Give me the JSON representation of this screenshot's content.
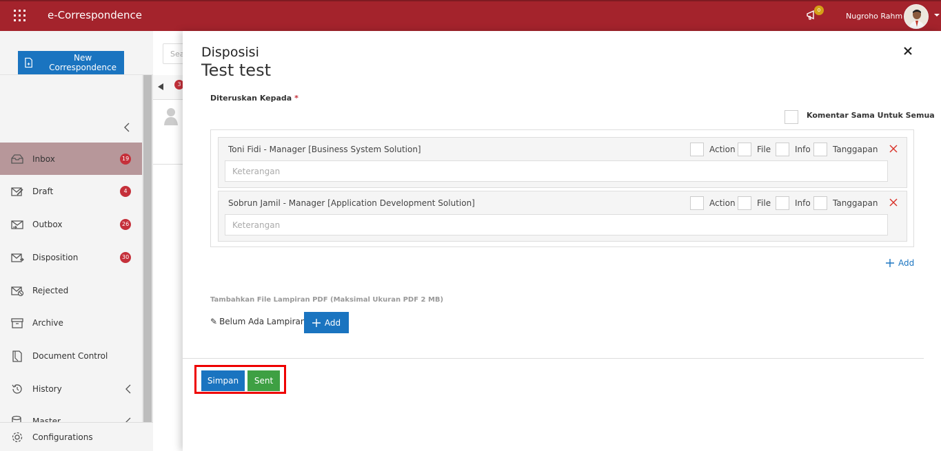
{
  "app": {
    "title": "e-Correspondence",
    "notification_count": "0",
    "user_name": "Nugroho Rahm"
  },
  "sidebar": {
    "new_button_label": "New Correspondence",
    "items": [
      {
        "label": "Inbox",
        "badge": "19",
        "icon": "inbox-icon",
        "active": true
      },
      {
        "label": "Draft",
        "badge": "4",
        "icon": "draft-icon"
      },
      {
        "label": "Outbox",
        "badge": "26",
        "icon": "outbox-icon"
      },
      {
        "label": "Disposition",
        "badge": "30",
        "icon": "disposition-icon"
      },
      {
        "label": "Rejected",
        "badge": "",
        "icon": "rejected-icon"
      },
      {
        "label": "Archive",
        "badge": "",
        "icon": "archive-icon"
      },
      {
        "label": "Document Control",
        "badge": "",
        "icon": "document-control-icon"
      },
      {
        "label": "History",
        "badge": "",
        "icon": "history-icon",
        "expandable": true
      },
      {
        "label": "Master",
        "badge": "",
        "icon": "master-icon",
        "expandable": true
      }
    ],
    "config_label": "Configurations"
  },
  "background_list": {
    "search_placeholder": "Sea",
    "badge": "3"
  },
  "modal": {
    "title": "Disposisi",
    "subtitle": "Test test",
    "forward_label": "Diteruskan Kepada",
    "required_mark": "*",
    "same_comment_label": "Komentar Sama Untuk Semua",
    "recipients": [
      {
        "name": "Toni Fidi - Manager [Business System Solution]",
        "placeholder": "Keterangan"
      },
      {
        "name": "Sobrun Jamil - Manager [Application Development Solution]",
        "placeholder": "Keterangan"
      }
    ],
    "options": [
      "Action",
      "File",
      "Info",
      "Tanggapan"
    ],
    "add_recipient_label": "Add",
    "attachment_label": "Tambahkan File Lampiran PDF (Maksimal Ukuran PDF 2 MB)",
    "no_attachment_text": "Belum Ada Lampiran -",
    "add_file_label": "Add",
    "save_label": "Simpan",
    "send_label": "Sent"
  },
  "colors": {
    "topbar": "#a4232c",
    "primary": "#1a74c0",
    "success": "#3ea043",
    "badge": "#c5303a",
    "highlight": "#e00000"
  }
}
